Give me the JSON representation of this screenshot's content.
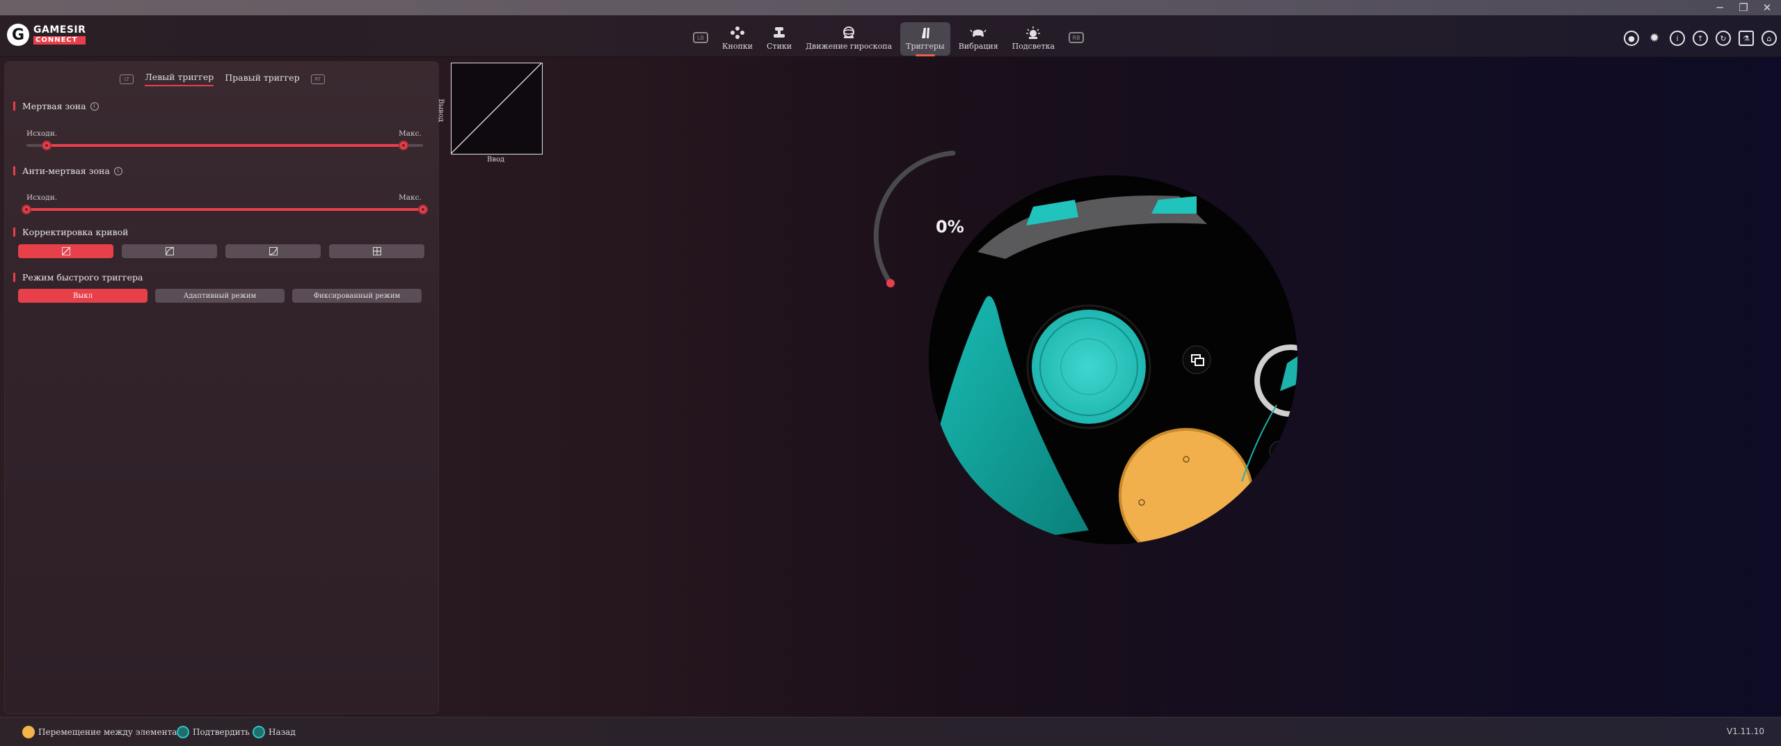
{
  "app": {
    "logo_line1": "GAMESIR",
    "logo_line2": "CONNECT",
    "logo_letter": "G"
  },
  "window_controls": {
    "minimize": "─",
    "restore": "❐",
    "close": "✕"
  },
  "nav": {
    "left_key": "LB",
    "right_key": "RB",
    "items": [
      {
        "label": "Кнопки",
        "icon": "buttons-icon"
      },
      {
        "label": "Стики",
        "icon": "sticks-icon"
      },
      {
        "label": "Движение гироскопа",
        "icon": "gyro-icon"
      },
      {
        "label": "Триггеры",
        "icon": "triggers-icon",
        "active": true
      },
      {
        "label": "Вибрация",
        "icon": "vibration-icon"
      },
      {
        "label": "Подсветка",
        "icon": "lighting-icon"
      }
    ]
  },
  "top_icons": [
    "record-icon",
    "brightness-icon",
    "info-icon",
    "upload-icon",
    "refresh-icon",
    "lab-icon",
    "home-icon"
  ],
  "panel": {
    "tabs": {
      "left_key": "LT",
      "right_key": "RT",
      "left_label": "Левый триггер",
      "right_label": "Правый триггер",
      "active": "left"
    },
    "deadzone": {
      "title": "Мертвая зона",
      "min_label": "Исходн.",
      "max_label": "Макс.",
      "min_value": 0.05,
      "max_value": 0.95
    },
    "anti_deadzone": {
      "title": "Анти-мертвая зона",
      "min_label": "Исходн.",
      "max_label": "Макс.",
      "min_value": 0.0,
      "max_value": 1.0
    },
    "curve": {
      "title": "Корректировка кривой",
      "presets": [
        "linear-curve-icon",
        "curve-2-icon",
        "curve-3-icon",
        "custom-curve-icon"
      ],
      "active_index": 0
    },
    "quick_trigger": {
      "title": "Режим быстрого триггера",
      "modes": [
        "Выкл",
        "Адаптивный режим",
        "Фиксированный режим"
      ],
      "active_index": 0
    }
  },
  "graph": {
    "x_label": "Ввод",
    "y_label": "Вывод"
  },
  "preview": {
    "percent": "0%",
    "trigger_level": 0
  },
  "footer": {
    "hints": [
      {
        "label": "Перемещение между элементами",
        "color": "#f2b44b"
      },
      {
        "label": "Подтвердить",
        "color": "#2ec4c4"
      },
      {
        "label": "Назад",
        "color": "#2ec4c4"
      }
    ],
    "version": "V1.11.10"
  }
}
